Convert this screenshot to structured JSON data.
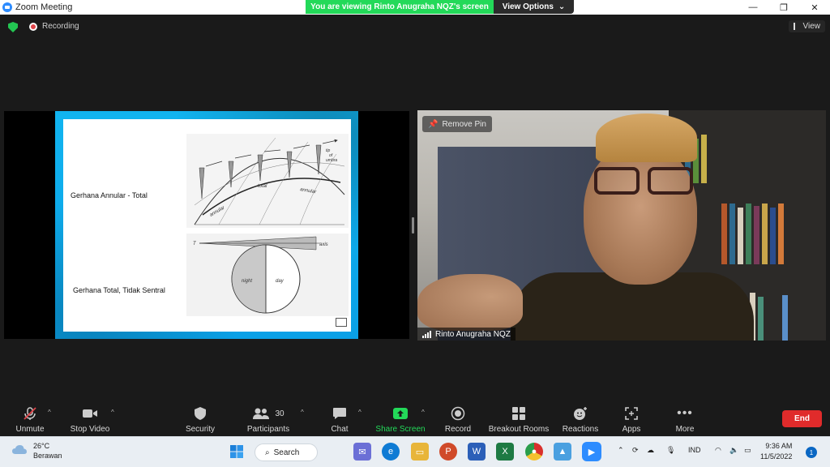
{
  "window": {
    "title": "Zoom Meeting",
    "banner": "You are viewing Rinto Anugraha NQZ's screen",
    "view_options": "View Options",
    "controls": {
      "minimize": "—",
      "restore": "❐",
      "close": "✕"
    }
  },
  "status": {
    "recording_label": "Recording",
    "view_label": "View"
  },
  "slide": {
    "label1": "Gerhana  Annular - Total",
    "label2": "Gerhana Total, Tidak Sentral",
    "fig1_labels": {
      "tip": "tip",
      "of": "of",
      "umbra": "umbra",
      "total": "total",
      "annular1": "annular",
      "annular2": "annular"
    },
    "fig2_labels": {
      "t": "T",
      "axis": "axis",
      "night": "night",
      "day": "day"
    }
  },
  "video": {
    "remove_pin": "Remove Pin",
    "participant_name": "Rinto Anugraha NQZ"
  },
  "toolbar": {
    "unmute": "Unmute",
    "stop_video": "Stop Video",
    "security": "Security",
    "participants": "Participants",
    "participants_count": "30",
    "chat": "Chat",
    "share_screen": "Share Screen",
    "record": "Record",
    "breakout_rooms": "Breakout Rooms",
    "reactions": "Reactions",
    "apps": "Apps",
    "more": "More",
    "end": "End"
  },
  "taskbar": {
    "temperature": "26°C",
    "weather": "Berawan",
    "search": "Search",
    "language": "IND",
    "time": "9:36 AM",
    "date": "11/5/2022",
    "notifications": "1"
  },
  "colors": {
    "accent_green": "#23d959",
    "end_red": "#e02b2b",
    "zoom_blue": "#2d8cff"
  }
}
